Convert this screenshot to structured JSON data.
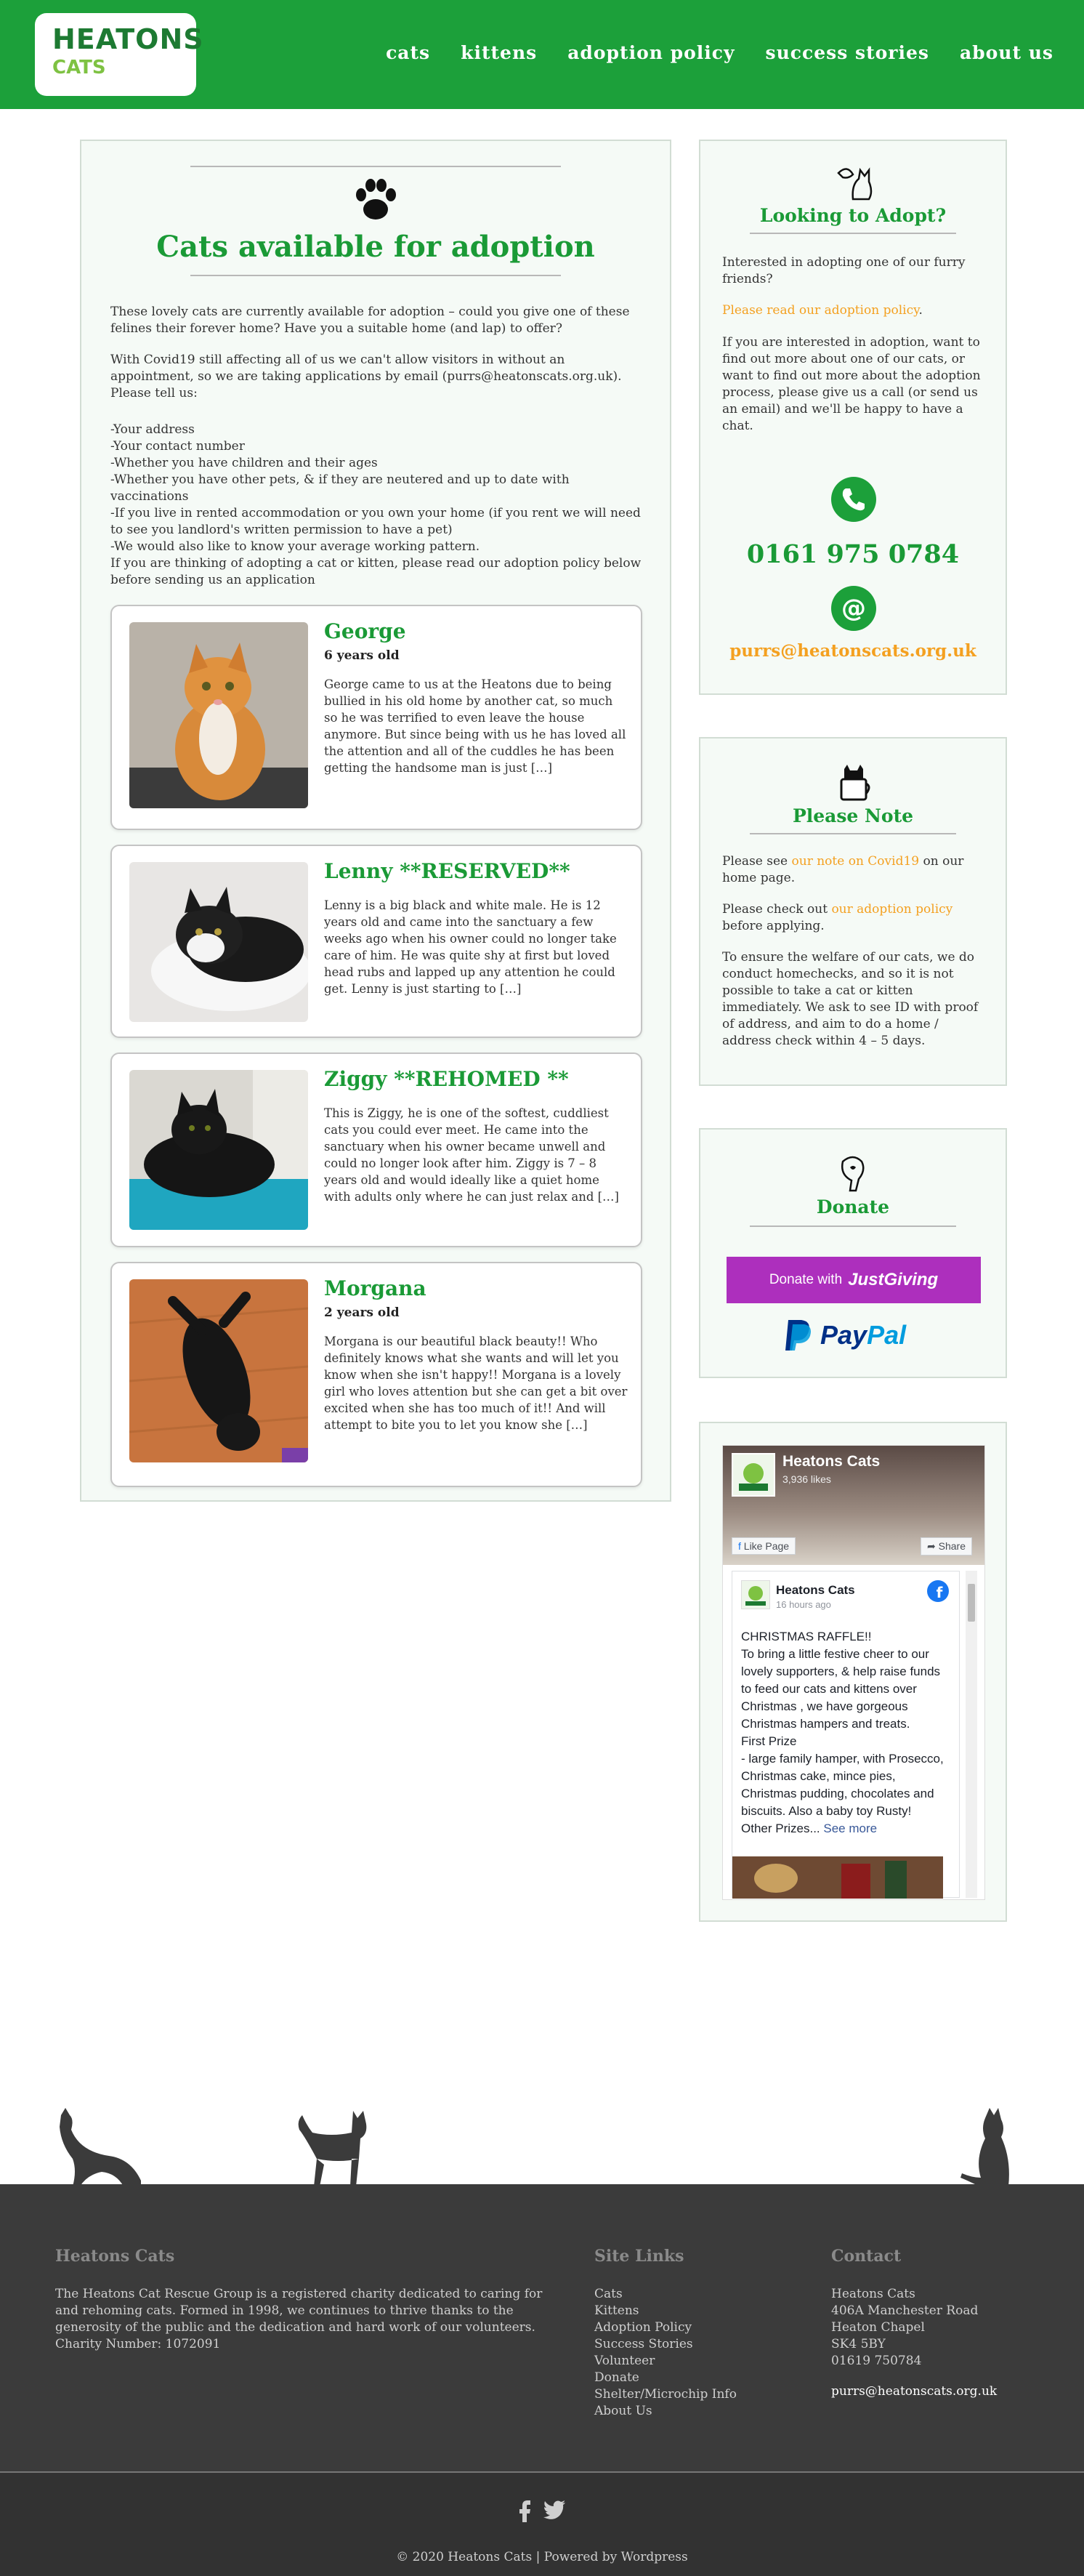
{
  "header": {
    "logo_line1": "HEATONS",
    "logo_line2": "CATS",
    "nav": [
      "cats",
      "kittens",
      "adoption policy",
      "success stories",
      "about us"
    ]
  },
  "main": {
    "title": "Cats available for adoption",
    "intro": "These lovely cats are currently available for adoption – could you give one of these felines their forever home? Have you a suitable home (and lap) to offer?",
    "covid": "With Covid19 still affecting all of us we can't allow visitors in without an appointment, so we are taking applications by email (purrs@heatonscats.org.uk). Please tell us:",
    "requirements": [
      "-Your address",
      "-Your contact number",
      "-Whether you have children and their ages",
      "-Whether you have other pets, & if they are neutered and up to date with vaccinations",
      "-If you live in rented accommodation or you own your home (if you rent we will need to see you landlord's written permission to have a pet)",
      "-We would also like to know your average working pattern."
    ],
    "outro": "If you are thinking of adopting a cat or kitten, please read our adoption policy below before sending us an application",
    "cats": [
      {
        "name": "George",
        "age": "6 years old",
        "description": "George came to us at the Heatons due to being bullied in his old home by another cat, so much so he was terrified to even leave the house anymore. But since being with us he has loved all the attention and all of the cuddles he has been getting the handsome man is just […]"
      },
      {
        "name": "Lenny **RESERVED**",
        "age": "",
        "description": "Lenny is a big black and white male. He is 12 years old and came into the sanctuary a few weeks ago when his owner could no longer take care of him. He was quite shy at first but loved head rubs and lapped up any attention he could get. Lenny is just starting to […]"
      },
      {
        "name": "Ziggy **REHOMED **",
        "age": "",
        "description": "This is Ziggy, he is one of the softest, cuddliest cats you could ever meet. He came into the sanctuary when his owner became unwell and could no longer look after him. Ziggy is 7 – 8 years old and would ideally like a quiet home with adults only where he can just relax and […]"
      },
      {
        "name": "Morgana",
        "age": "2 years old",
        "description": "Morgana is our beautiful black beauty!! Who definitely knows what she wants and will let you know when she isn't happy!! Morgana is a lovely girl who loves attention but she can get a bit over excited when she has too much of it!! And will attempt to bite you to let you know she […]"
      }
    ]
  },
  "adopt": {
    "title": "Looking to Adopt?",
    "p1": "Interested in adopting one of our furry friends?",
    "p2_link": "Please read our adoption policy",
    "p2_end": ".",
    "p3": "If you are interested in adoption, want to find out more about one of our cats, or want to find out more about the adoption process, please give us a call (or send us an email) and we'll be happy to have a chat.",
    "phone": "0161 975 0784",
    "email": "purrs@heatonscats.org.uk"
  },
  "note": {
    "title": "Please Note",
    "p1_pre": "Please see ",
    "p1_link": "our note on Covid19",
    "p1_post": " on our home page.",
    "p2_pre": "Please check out ",
    "p2_link": "our adoption policy",
    "p2_post": " before applying.",
    "p3": "To ensure the welfare of our cats, we do conduct homechecks, and so it is not possible to take a cat or kitten immediately. We ask to see ID with proof of address, and aim to do a home / address check within 4 – 5 days."
  },
  "donate": {
    "title": "Donate",
    "jg_pre": "Donate with",
    "jg_brand": "JustGiving",
    "paypal1": "Pay",
    "paypal2": "Pal"
  },
  "facebook": {
    "page_name": "Heatons Cats",
    "likes": "3,936 likes",
    "like_btn": "Like Page",
    "share_btn": "Share",
    "post_author": "Heatons Cats",
    "post_time": "16 hours ago",
    "post_body": "CHRISTMAS RAFFLE!!\nTo bring a little festive cheer to our lovely supporters, & help raise funds to feed our cats and kittens over Christmas , we have gorgeous Christmas hampers and treats.\nFirst Prize\n- large family hamper, with Prosecco, Christmas cake, mince pies, Christmas pudding, chocolates and biscuits. Also a baby toy Rusty!\nOther Prizes...",
    "see_more": "See more"
  },
  "footer": {
    "about_title": "Heatons Cats",
    "about_text": "The Heatons Cat Rescue Group is a registered charity dedicated to caring for and rehoming cats. Formed in 1998, we continues to thrive thanks to the generosity of the public and the dedication and hard work of our volunteers.",
    "charity": "Charity Number: 1072091",
    "links_title": "Site Links",
    "links": [
      "Cats",
      "Kittens",
      "Adoption Policy",
      "Success Stories",
      "Volunteer",
      "Donate",
      "Shelter/Microchip Info",
      "About Us"
    ],
    "contact_title": "Contact",
    "contact_lines": [
      "Heatons Cats",
      "406A Manchester Road",
      "Heaton Chapel",
      "SK4 5BY",
      "01619 750784"
    ],
    "contact_email": "purrs@heatonscats.org.uk",
    "copyright": "© 2020 Heatons Cats | Powered by Wordpress"
  },
  "colors": {
    "brand_green": "#1ca03a",
    "accent_orange": "#f4a020",
    "footer_bg": "#3b3b3b",
    "justgiving_purple": "#ad2fbd"
  }
}
